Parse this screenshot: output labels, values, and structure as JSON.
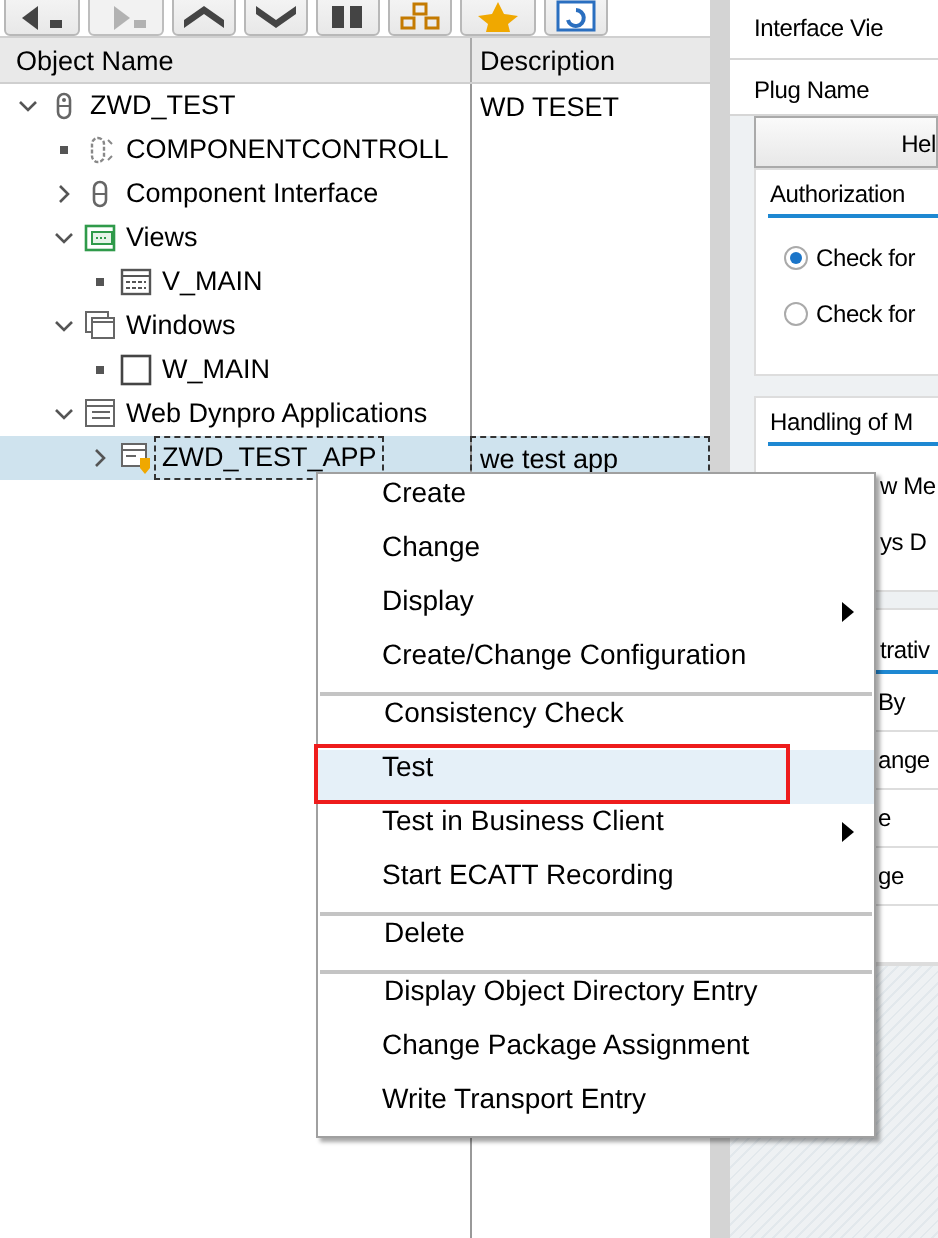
{
  "toolbar": {
    "buttons": [
      {
        "kind": "back",
        "disabled": false
      },
      {
        "kind": "forward",
        "disabled": true
      },
      {
        "kind": "expand",
        "disabled": false
      },
      {
        "kind": "collapse",
        "disabled": false
      },
      {
        "kind": "columns",
        "disabled": false
      },
      {
        "kind": "hierarchy",
        "disabled": false
      },
      {
        "kind": "favorite",
        "disabled": false
      },
      {
        "kind": "refresh",
        "disabled": false
      }
    ]
  },
  "tree": {
    "columns": [
      "Object Name",
      "Description"
    ],
    "nodes": [
      {
        "name": "ZWD_TEST",
        "description": "WD TESET",
        "kind": "component",
        "expandable": true,
        "expanded": true,
        "selected": false,
        "children": [
          {
            "name": "COMPONENTCONTROLL",
            "kind": "controller",
            "expandable": false,
            "selected": false
          },
          {
            "name": "Component Interface",
            "kind": "interface",
            "expandable": true,
            "expanded": false,
            "selected": false
          },
          {
            "name": "Views",
            "kind": "views",
            "expandable": true,
            "expanded": true,
            "selected": false,
            "children": [
              {
                "name": "V_MAIN",
                "kind": "view",
                "expandable": false,
                "selected": false
              }
            ]
          },
          {
            "name": "Windows",
            "kind": "windows",
            "expandable": true,
            "expanded": true,
            "selected": false,
            "children": [
              {
                "name": "W_MAIN",
                "kind": "window",
                "expandable": false,
                "selected": false
              }
            ]
          },
          {
            "name": "Web Dynpro Applications",
            "kind": "applications",
            "expandable": true,
            "expanded": true,
            "selected": false,
            "children": [
              {
                "name": "ZWD_TEST_APP",
                "description": "we test app",
                "kind": "application",
                "expandable": true,
                "expanded": false,
                "selected": true
              }
            ]
          }
        ]
      }
    ]
  },
  "detail": {
    "header_label": "Interface Vie",
    "plug_label": "Plug Name",
    "column_header": "Hel",
    "authorization_group": {
      "title": "Authorization",
      "options": [
        {
          "label": "Check for",
          "selected": true
        },
        {
          "label": "Check for",
          "selected": false
        }
      ]
    },
    "messages_group": {
      "title": "Handling of M",
      "fragments": [
        "w Me",
        "ys D"
      ]
    },
    "admin_group": {
      "title": "trativ",
      "fragments": [
        "By",
        "ange",
        "e",
        "ge"
      ]
    }
  },
  "context_menu": {
    "items": [
      {
        "label": "Create",
        "separator_before": false,
        "submenu": false,
        "selected": false,
        "highlighted": false
      },
      {
        "label": "Change",
        "separator_before": false,
        "submenu": false,
        "selected": false,
        "highlighted": false
      },
      {
        "label": "Display",
        "separator_before": false,
        "submenu": true,
        "selected": false,
        "highlighted": false
      },
      {
        "label": "Create/Change Configuration",
        "separator_before": false,
        "submenu": false,
        "selected": false,
        "highlighted": false
      },
      {
        "label": "Consistency Check",
        "separator_before": true,
        "submenu": false,
        "selected": false,
        "highlighted": false
      },
      {
        "label": "Test",
        "separator_before": false,
        "submenu": false,
        "selected": true,
        "highlighted": true
      },
      {
        "label": "Test in Business Client",
        "separator_before": false,
        "submenu": true,
        "selected": false,
        "highlighted": false
      },
      {
        "label": "Start ECATT Recording",
        "separator_before": false,
        "submenu": false,
        "selected": false,
        "highlighted": false
      },
      {
        "label": "Delete",
        "separator_before": true,
        "submenu": false,
        "selected": false,
        "highlighted": false
      },
      {
        "label": "Display Object Directory Entry",
        "separator_before": true,
        "submenu": false,
        "selected": false,
        "highlighted": false
      },
      {
        "label": "Change Package Assignment",
        "separator_before": false,
        "submenu": false,
        "selected": false,
        "highlighted": false
      },
      {
        "label": "Write Transport Entry",
        "separator_before": false,
        "submenu": false,
        "selected": false,
        "highlighted": false
      }
    ]
  }
}
